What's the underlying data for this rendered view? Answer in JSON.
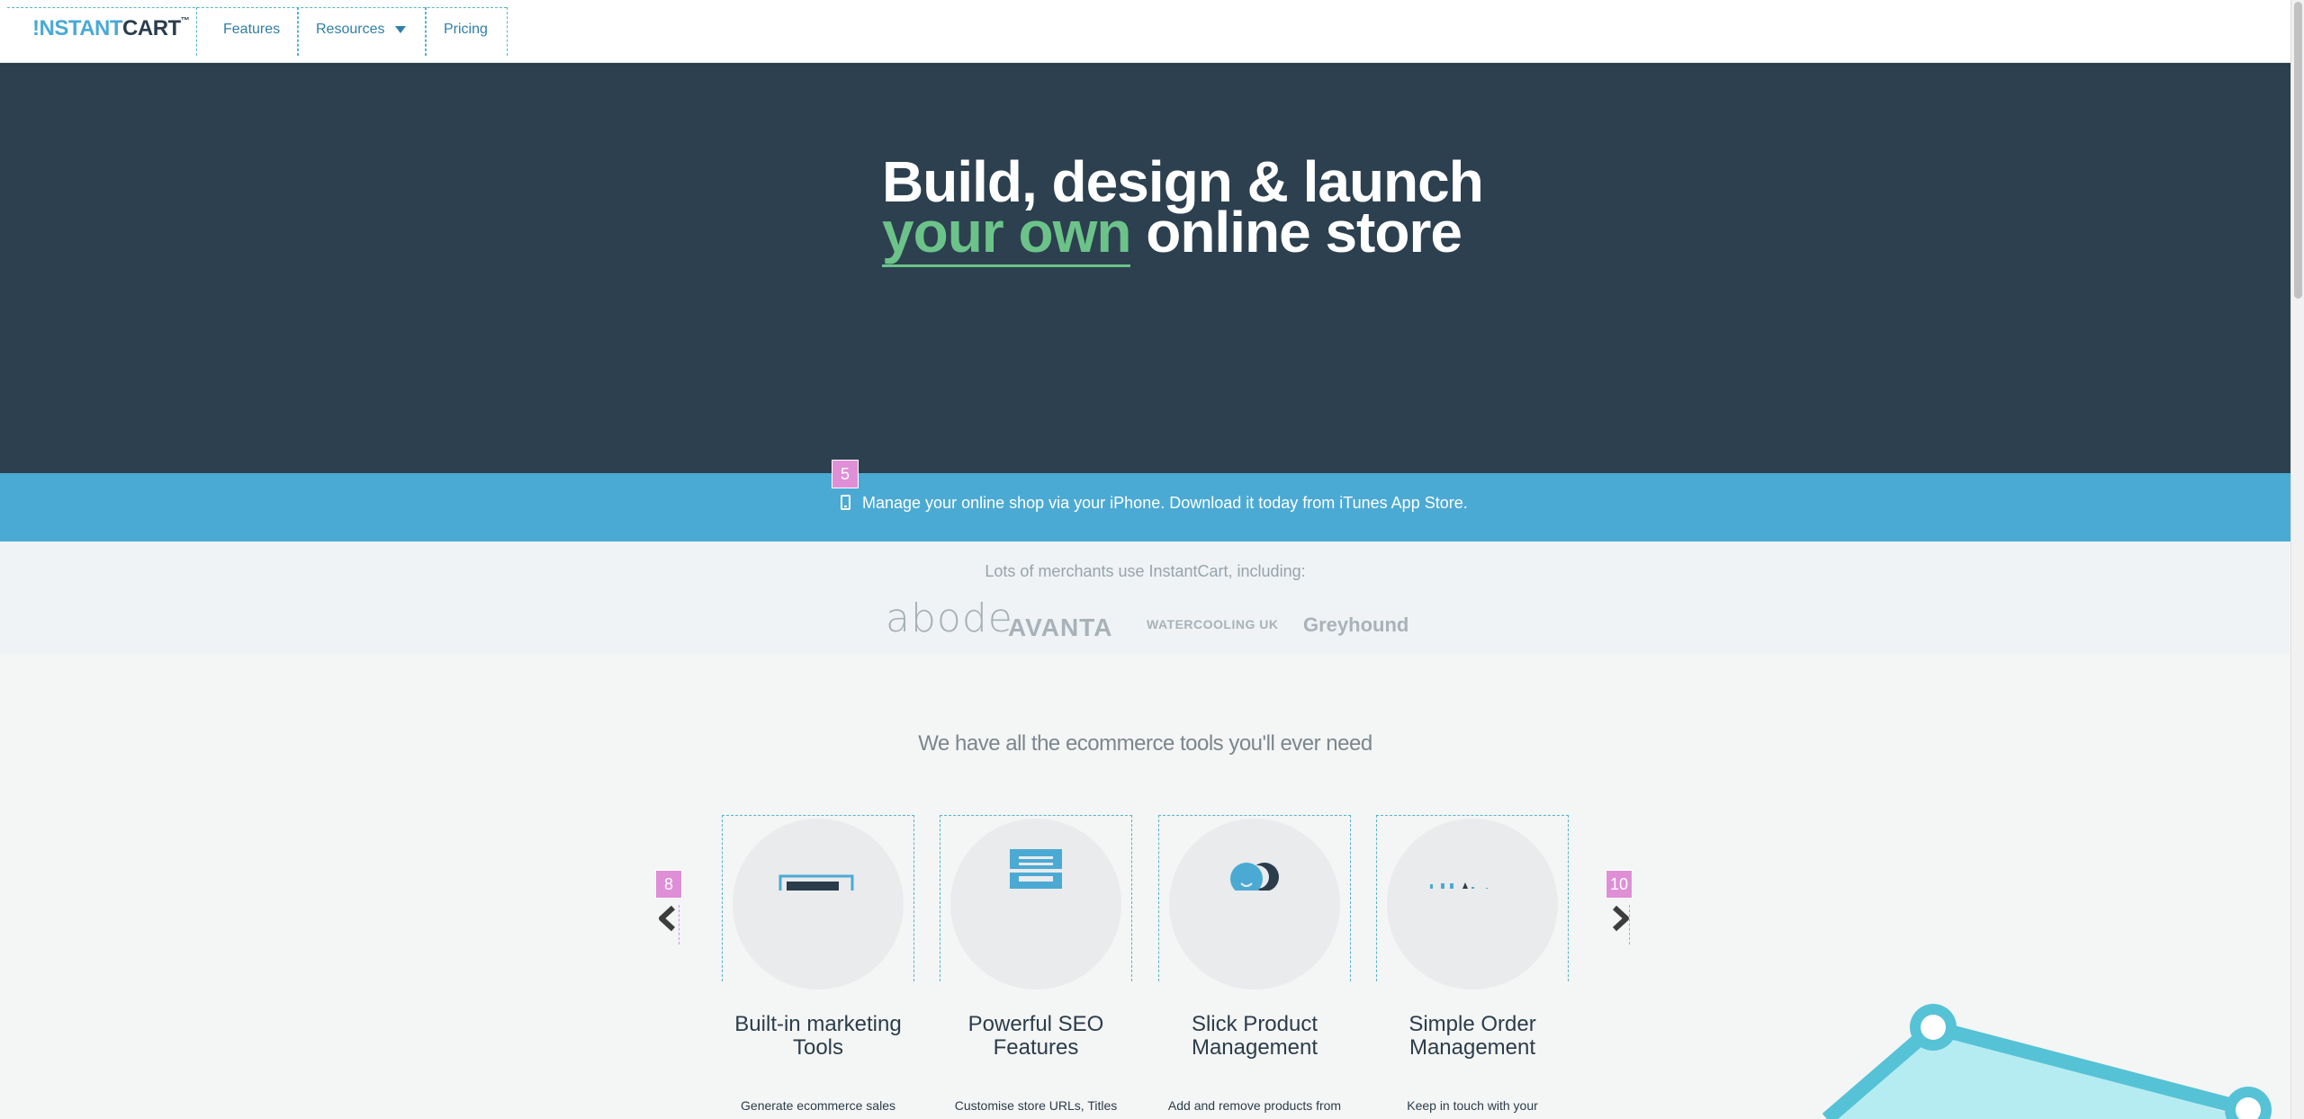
{
  "nav": {
    "logo_bang": "!",
    "logo_instant": "NSTANT",
    "logo_cart": "CART",
    "logo_tm": "™",
    "links": [
      "Features",
      "Resources",
      "Pricing"
    ]
  },
  "hero": {
    "line1": "Build, design & launch",
    "accent": "your own",
    "line2_rest": " online store"
  },
  "appbar": {
    "text": "Manage your online shop via your iPhone. Download it today from iTunes App Store.",
    "marker": "5"
  },
  "merchants": {
    "title": "Lots of merchants use InstantCart, including:",
    "logos": [
      "abode",
      "AVANTA",
      "WATERCOOLING UK",
      "Greyhound"
    ]
  },
  "tools": {
    "title": "We have all the ecommerce tools you'll ever need",
    "prev_marker": "8",
    "next_marker": "10",
    "items": [
      {
        "name": "Built-in marketing Tools",
        "desc": "Generate ecommerce sales"
      },
      {
        "name": "Powerful SEO Features",
        "desc": "Customise store URLs, Titles"
      },
      {
        "name": "Slick Product Management",
        "desc": "Add and remove products from"
      },
      {
        "name": "Simple Order Management",
        "desc": "Keep in touch with your"
      }
    ]
  },
  "colors": {
    "hero_bg": "#2c404f",
    "appbar_bg": "#4baad3",
    "accent_green": "#6cc389",
    "link_blue": "#2f7fa7"
  }
}
